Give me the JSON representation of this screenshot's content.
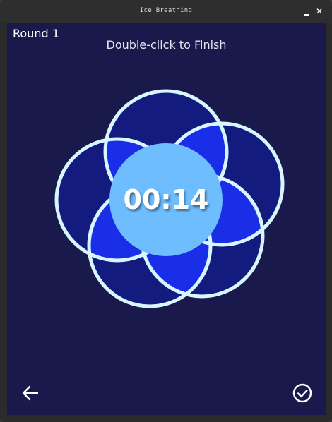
{
  "window": {
    "title": "Ice Breathing",
    "minimize_icon": "minimize-icon",
    "close_icon": "close-icon",
    "close_glyph": "✕"
  },
  "header": {
    "round_label": "Round 1",
    "instruction": "Double-click to Finish"
  },
  "timer": {
    "value": "00:14"
  },
  "footer": {
    "back_icon": "arrow-left-icon",
    "finish_icon": "check-circle-icon"
  },
  "colors": {
    "background": "#1a194c",
    "petal_fill": "#131c7e",
    "petal_overlap": "#1a2ee8",
    "petal_stroke": "#d8f6ff",
    "timer_circle": "#6ebeff"
  }
}
